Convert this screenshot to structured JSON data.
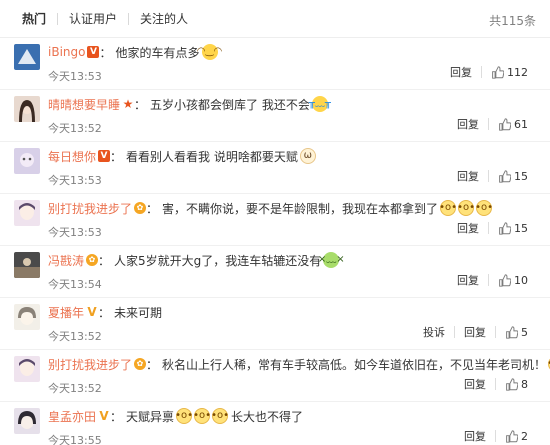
{
  "tabs": [
    {
      "label": "热门"
    },
    {
      "label": "认证用户"
    },
    {
      "label": "关注的人"
    }
  ],
  "total": "共115条",
  "comments": [
    {
      "user": "iBingo",
      "badge": "V",
      "text": "他家的车有点多",
      "emoji": "😂",
      "time": "今天13:53",
      "reply": "回复",
      "likes": "112"
    },
    {
      "user": "晴晴想要早睡",
      "badge": "★",
      "text": "五岁小孩都会倒库了 我还不会",
      "emoji": "😭",
      "time": "今天13:52",
      "reply": "回复",
      "likes": "61"
    },
    {
      "user": "每日想你",
      "badge": "V",
      "text": "看看别人看看我 说明啥都要天赋",
      "emoji": "🐱",
      "time": "今天13:53",
      "reply": "回复",
      "likes": "15"
    },
    {
      "user": "别打扰我进步了",
      "badge": "✿",
      "text": "害，不瞒你说，要不是年龄限制，我现在本都拿到了",
      "emojis": [
        "😯",
        "😯",
        "😯"
      ],
      "time": "今天13:53",
      "reply": "回复",
      "likes": "15"
    },
    {
      "user": "冯戡涛",
      "badge": "✿",
      "text": "人家5岁就开大g了，我连车轱辘还没有",
      "emoji": "🤢",
      "time": "今天13:54",
      "reply": "回复",
      "likes": "10"
    },
    {
      "user": "夏播年",
      "badge": "V",
      "text": "未来可期",
      "time": "今天13:52",
      "report": "投诉",
      "reply": "回复",
      "likes": "5"
    },
    {
      "user": "别打扰我进步了",
      "badge": "✿",
      "text": "秋名山上行人稀，常有车手较高低。如今车道依旧在，不见当年老司机！",
      "emoji": "😯",
      "time": "今天13:52",
      "reply": "回复",
      "likes": "8"
    },
    {
      "user": "皇孟亦田",
      "badge": "V",
      "text_a": "天赋异禀",
      "emojis": [
        "😯",
        "😯",
        "😯"
      ],
      "text_b": "长大也不得了",
      "time": "今天13:55",
      "reply": "回复",
      "likes": "2"
    }
  ],
  "colors": {
    "username": "#eb7350",
    "meta": "#808080",
    "accent": "#e8541e"
  }
}
